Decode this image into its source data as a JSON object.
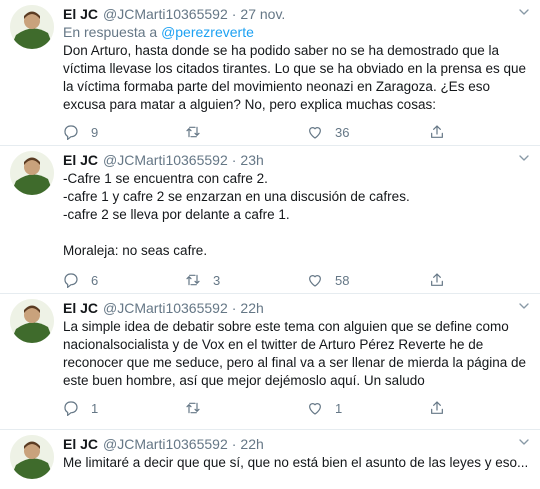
{
  "tweets": [
    {
      "name": "El JC",
      "handle": "@JCMarti10365592",
      "time": "27 nov.",
      "reply_label": "En respuesta a",
      "reply_handle": "@perezreverte",
      "text": "Don Arturo, hasta donde se ha podido saber no se ha demostrado que la víctima llevase los citados tirantes. Lo que se ha obviado en la prensa es que la víctima formaba parte del movimiento neonazi en Zaragoza. ¿Es eso excusa para matar a alguien? No, pero explica muchas cosas:",
      "replies": "9",
      "retweets": "",
      "likes": "36"
    },
    {
      "name": "El JC",
      "handle": "@JCMarti10365592",
      "time": "23h",
      "text": "-Cafre 1 se encuentra con cafre 2.\n-cafre 1 y cafre 2 se enzarzan en una discusión de cafres.\n-cafre 2 se lleva por delante a cafre 1.\n\nMoraleja: no seas cafre.",
      "replies": "6",
      "retweets": "3",
      "likes": "58"
    },
    {
      "name": "El JC",
      "handle": "@JCMarti10365592",
      "time": "22h",
      "text": "La simple idea de debatir sobre este tema con alguien que se define como nacionalsocialista y de Vox en el twitter de Arturo Pérez Reverte he de reconocer que me seduce, pero al final va a ser llenar de mierda la página de este buen hombre, así que mejor dejémoslo aquí. Un saludo",
      "replies": "1",
      "retweets": "",
      "likes": "1"
    },
    {
      "name": "El JC",
      "handle": "@JCMarti10365592",
      "time": "22h",
      "text": "Me limitaré a decir que que sí, que no está bien el asunto de las leyes y eso..."
    }
  ]
}
